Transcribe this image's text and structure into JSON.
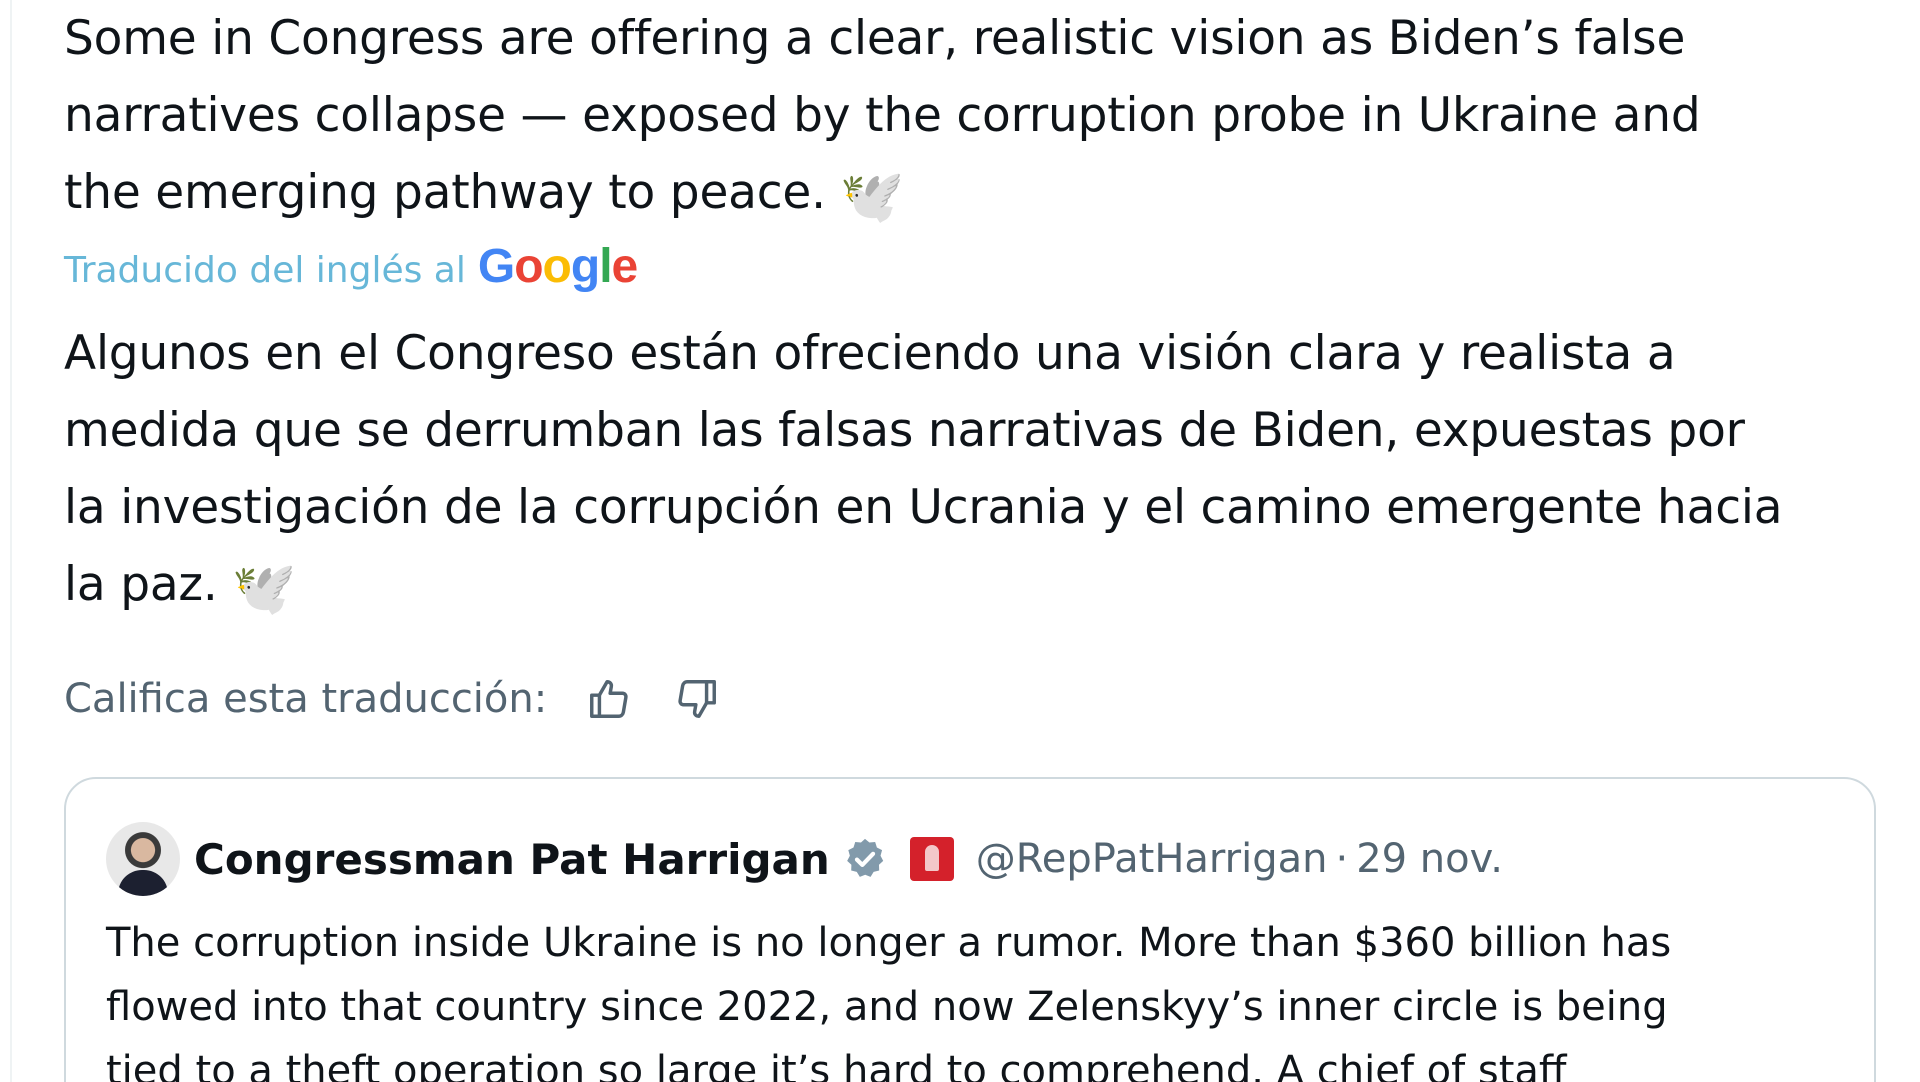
{
  "post": {
    "original_text": "Some in Congress are offering a clear, realistic vision as Biden’s false\nnarratives collapse — exposed by the corruption probe in Ukraine and\nthe emerging pathway to peace.",
    "dove_emoji": "🕊️",
    "translated_by_label": "Traducido del inglés al",
    "translator_logo": "Google",
    "translated_text": "Algunos en el Congreso están ofreciendo una visión clara y realista a\nmedida que se derrumban las falsas narrativas de Biden, expuestas por\nla investigación de la corrupción en Ucrania y el camino emergente hacia\nla paz.",
    "rate_label": "Califica esta traducción:"
  },
  "quoted_post": {
    "author_name": "Congressman Pat Harrigan",
    "handle": "@RepPatHarrigan",
    "separator": "·",
    "date": "29 nov.",
    "text": "The corruption inside Ukraine is no longer a rumor. More than $360 billion has\nflowed into that country since 2022, and now Zelenskyy’s inner circle is being\ntied to a theft operation so large it’s hard to comprehend. A chief of staff"
  },
  "icons": {
    "thumbs_up": "thumbs-up-icon",
    "thumbs_down": "thumbs-down-icon",
    "verified": "verified-badge-icon",
    "affiliation": "affiliation-badge-icon"
  },
  "colors": {
    "text": "#0f1419",
    "muted": "#536471",
    "translated_by": "#67b7d8",
    "border": "#cfd9de",
    "verified": "#829aab",
    "affiliation": "#d4212b"
  }
}
